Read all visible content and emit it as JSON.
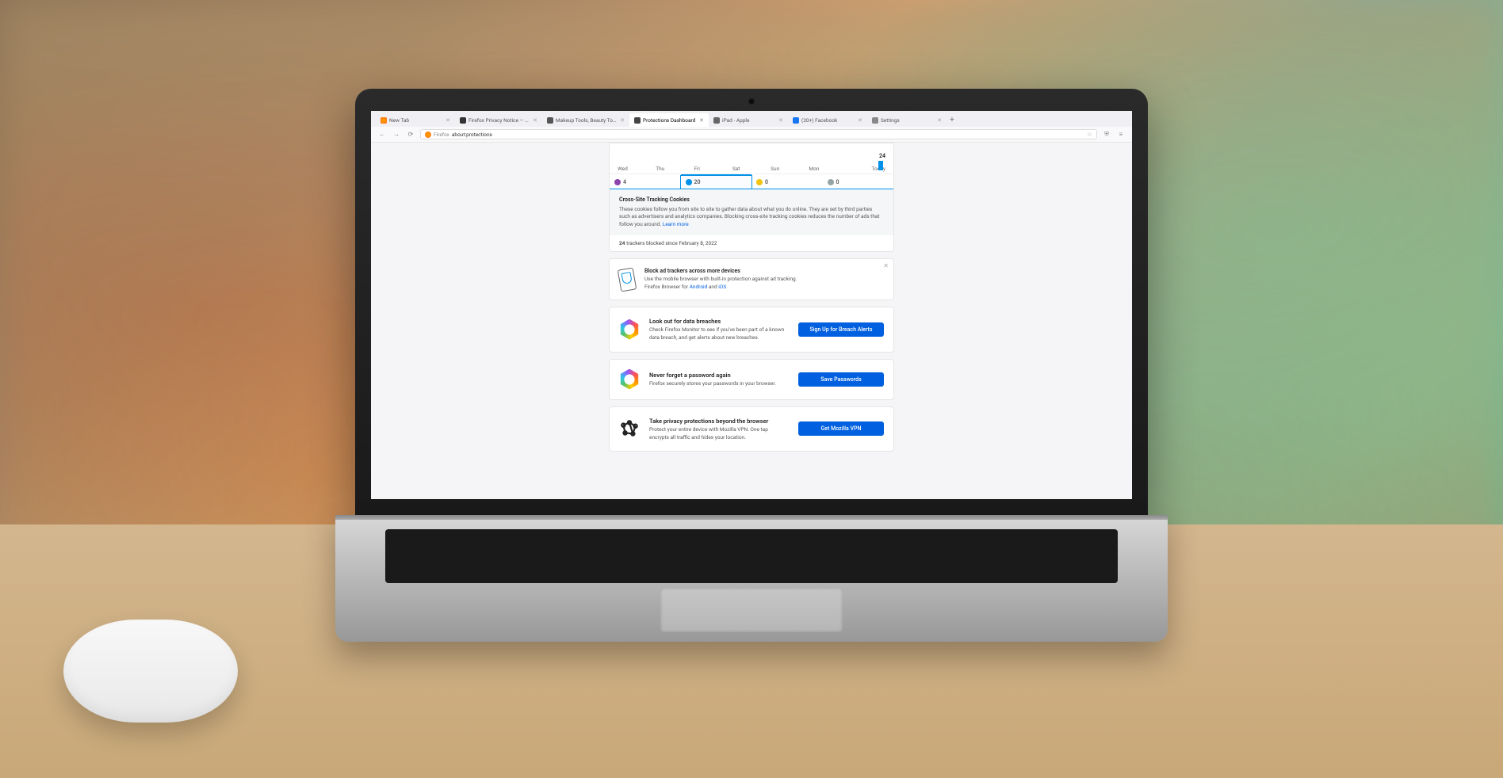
{
  "tabs": [
    {
      "label": "New Tab",
      "fav": "fav-firefox"
    },
    {
      "label": "Firefox Privacy Notice — Mozilla",
      "fav": "fav-dark"
    },
    {
      "label": "Makeup Tools, Beauty Tools & ...",
      "fav": "fav-info"
    },
    {
      "label": "Protections Dashboard",
      "fav": "fav-shield",
      "active": true
    },
    {
      "label": "iPad - Apple",
      "fav": "fav-apple"
    },
    {
      "label": "(20+) Facebook",
      "fav": "fav-fb"
    },
    {
      "label": "Settings",
      "fav": "fav-gear"
    }
  ],
  "url": {
    "brand": "Firefox",
    "path": "about:protections"
  },
  "graph": {
    "today_count": "24",
    "days": [
      "Wed",
      "Thu",
      "Fri",
      "Sat",
      "Sun",
      "Mon",
      "Today"
    ],
    "types": [
      {
        "count": "4",
        "dot": "dot-purple"
      },
      {
        "count": "20",
        "dot": "dot-blue",
        "selected": true
      },
      {
        "count": "0",
        "dot": "dot-yellow"
      },
      {
        "count": "0",
        "dot": "dot-grey"
      }
    ],
    "info": {
      "title": "Cross-Site Tracking Cookies",
      "body": "These cookies follow you from site to site to gather data about what you do online. They are set by third parties such as advertisers and analytics companies. Blocking cross-site tracking cookies reduces the number of ads that follow you around.",
      "learn": "Learn more"
    },
    "since": {
      "count": "24",
      "text": " trackers blocked since February 8, 2022"
    }
  },
  "mobile": {
    "title": "Block ad trackers across more devices",
    "body": "Use the mobile browser with built-in protection against ad tracking.",
    "line2a": "Firefox Browser for ",
    "link1": "Android",
    "and": " and ",
    "link2": "iOS"
  },
  "cards": [
    {
      "title": "Look out for data breaches",
      "body": "Check Firefox Monitor to see if you've been part of a known data breach, and get alerts about new breaches.",
      "cta": "Sign Up for Breach Alerts",
      "icon": "monitor"
    },
    {
      "title": "Never forget a password again",
      "body": "Firefox securely stores your passwords in your browser.",
      "cta": "Save Passwords",
      "icon": "lockwise"
    },
    {
      "title": "Take privacy protections beyond the browser",
      "body": "Protect your entire device with Mozilla VPN. One tap encrypts all traffic and hides your location.",
      "cta": "Get Mozilla VPN",
      "icon": "vpn"
    }
  ]
}
